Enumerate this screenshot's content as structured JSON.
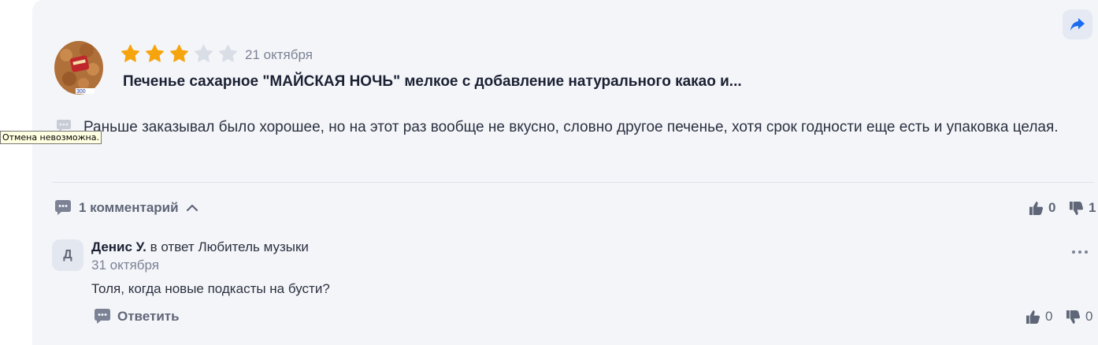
{
  "review": {
    "rating": 3,
    "rating_max": 5,
    "date": "21 октября",
    "product_title": "Печенье сахарное \"МАЙСКАЯ НОЧЬ\" мелкое с добавление натурального какао и...",
    "text": "Раньше заказывал было хорошее, но на этот раз вообще не вкусно, словно другое печенье, хотя срок годности еще есть и упаковка целая.",
    "likes": "0",
    "dislikes": "1"
  },
  "tooltip": "Отмена невозможна.",
  "comments": {
    "toggle_label": "1 комментарий",
    "items": [
      {
        "avatar_letter": "Д",
        "author": "Денис У.",
        "reply_to": "в ответ Любитель музыки",
        "date": "31 октября",
        "text": "Толя, когда новые подкасты на бусти?",
        "reply_label": "Ответить",
        "likes": "0",
        "dislikes": "0"
      }
    ]
  },
  "colors": {
    "star_active": "#f6a40d",
    "star_inactive": "#d9dde6",
    "share_icon": "#1a6cf0",
    "card_bg": "#f4f5f9"
  },
  "icons": [
    "share-icon",
    "star-icon",
    "message-icon",
    "chevron-up-icon",
    "thumbs-up-icon",
    "thumbs-down-icon",
    "more-icon"
  ]
}
